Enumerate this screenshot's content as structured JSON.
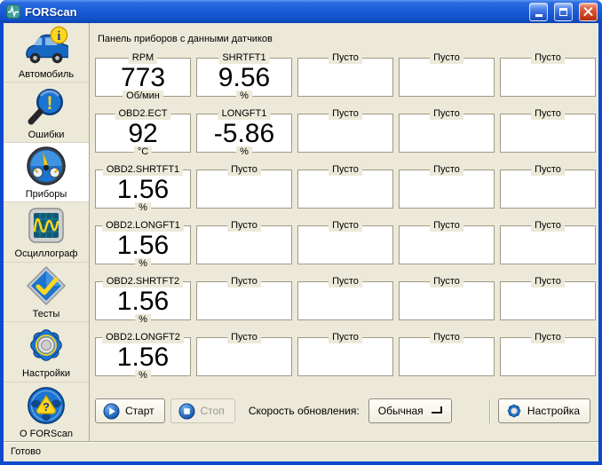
{
  "titlebar": {
    "title": "FORScan"
  },
  "sidebar": {
    "items": [
      {
        "id": "car",
        "label": "Автомобиль",
        "icon": "car-info-icon",
        "selected": false
      },
      {
        "id": "errors",
        "label": "Ошибки",
        "icon": "dtc-search-icon",
        "selected": false
      },
      {
        "id": "gauges",
        "label": "Приборы",
        "icon": "gauges-icon",
        "selected": true
      },
      {
        "id": "oscilloscope",
        "label": "Осциллограф",
        "icon": "oscilloscope-icon",
        "selected": false
      },
      {
        "id": "tests",
        "label": "Тесты",
        "icon": "tests-check-icon",
        "selected": false
      },
      {
        "id": "settings",
        "label": "Настройки",
        "icon": "settings-gear-icon",
        "selected": false
      },
      {
        "id": "about",
        "label": "О FORScan",
        "icon": "about-wheel-icon",
        "selected": false
      }
    ]
  },
  "main": {
    "header": "Панель приборов с данными датчиков",
    "grid": {
      "columns": 5,
      "rows": 6,
      "cells": [
        {
          "label": "RPM",
          "value": "773",
          "unit": "Об/мин"
        },
        {
          "label": "SHRTFT1",
          "value": "9.56",
          "unit": "%"
        },
        {
          "label": "Пусто"
        },
        {
          "label": "Пусто"
        },
        {
          "label": "Пусто"
        },
        {
          "label": "OBD2.ECT",
          "value": "92",
          "unit": "°C"
        },
        {
          "label": "LONGFT1",
          "value": "-5.86",
          "unit": "%"
        },
        {
          "label": "Пусто"
        },
        {
          "label": "Пусто"
        },
        {
          "label": "Пусто"
        },
        {
          "label": "OBD2.SHRTFT1",
          "value": "1.56",
          "unit": "%"
        },
        {
          "label": "Пусто"
        },
        {
          "label": "Пусто"
        },
        {
          "label": "Пусто"
        },
        {
          "label": "Пусто"
        },
        {
          "label": "OBD2.LONGFT1",
          "value": "1.56",
          "unit": "%"
        },
        {
          "label": "Пусто"
        },
        {
          "label": "Пусто"
        },
        {
          "label": "Пусто"
        },
        {
          "label": "Пусто"
        },
        {
          "label": "OBD2.SHRTFT2",
          "value": "1.56",
          "unit": "%"
        },
        {
          "label": "Пусто"
        },
        {
          "label": "Пусто"
        },
        {
          "label": "Пусто"
        },
        {
          "label": "Пусто"
        },
        {
          "label": "OBD2.LONGFT2",
          "value": "1.56",
          "unit": "%"
        },
        {
          "label": "Пусто"
        },
        {
          "label": "Пусто"
        },
        {
          "label": "Пусто"
        },
        {
          "label": "Пусто"
        }
      ]
    },
    "controls": {
      "start": "Старт",
      "stop": "Стоп",
      "stop_enabled": false,
      "refresh_rate_label": "Скорость обновления:",
      "refresh_rate_value": "Обычная",
      "settings": "Настройка"
    }
  },
  "statusbar": {
    "text": "Готово"
  },
  "colors": {
    "background": "#ece9d8",
    "cell_background": "#ffffff",
    "cell_border": "#9e9a88",
    "titlebar_blue": "#1b5cd9",
    "accent_blue": "#1b74cf",
    "accent_yellow": "#ffd61e",
    "close_red": "#ce3f20"
  }
}
